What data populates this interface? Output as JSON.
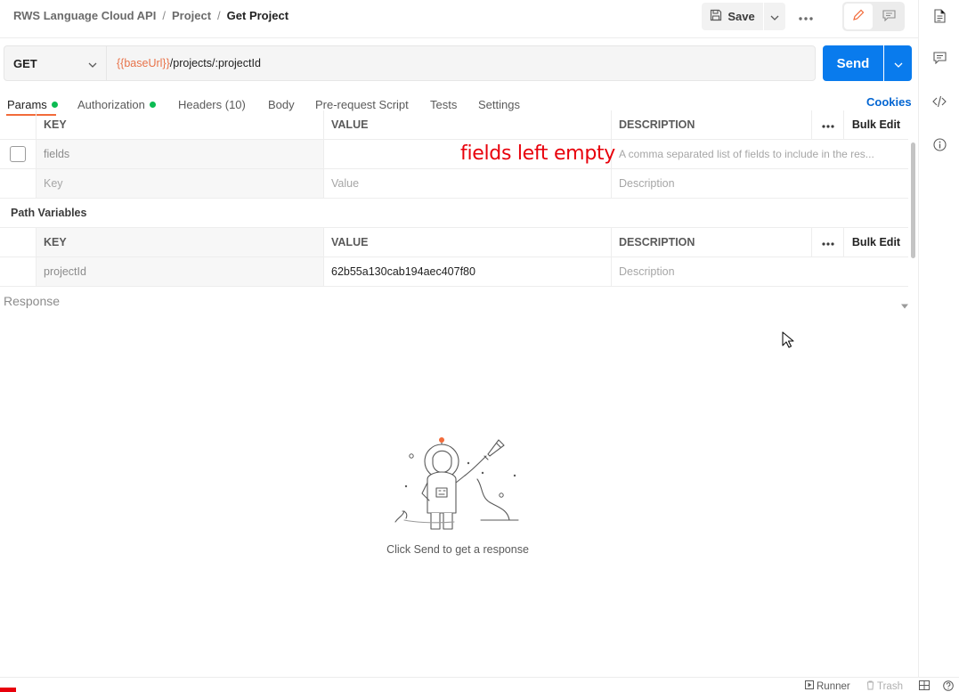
{
  "breadcrumb": {
    "items": [
      "RWS Language Cloud API",
      "Project"
    ],
    "separator": "/",
    "current": "Get Project"
  },
  "toolbar": {
    "save_label": "Save"
  },
  "request": {
    "method": "GET",
    "url_variable": "{{baseUrl}}",
    "url_path": "/projects/:projectId",
    "send_label": "Send"
  },
  "tabs": [
    {
      "label": "Params",
      "has_dot": true,
      "active": true
    },
    {
      "label": "Authorization",
      "has_dot": true,
      "active": false
    },
    {
      "label": "Headers (10)",
      "has_dot": false,
      "active": false
    },
    {
      "label": "Body",
      "has_dot": false,
      "active": false
    },
    {
      "label": "Pre-request Script",
      "has_dot": false,
      "active": false
    },
    {
      "label": "Tests",
      "has_dot": false,
      "active": false
    },
    {
      "label": "Settings",
      "has_dot": false,
      "active": false
    }
  ],
  "cookies_label": "Cookies",
  "query_params": {
    "headers": {
      "key": "KEY",
      "value": "VALUE",
      "description": "DESCRIPTION",
      "bulk_edit": "Bulk Edit"
    },
    "rows": [
      {
        "key": "fields",
        "value": "",
        "description": "A comma separated list of fields to include in the res..."
      }
    ],
    "new_row": {
      "key": "Key",
      "value": "Value",
      "description": "Description"
    }
  },
  "annotation": "fields left empty",
  "path_variables": {
    "title": "Path Variables",
    "headers": {
      "key": "KEY",
      "value": "VALUE",
      "description": "DESCRIPTION",
      "bulk_edit": "Bulk Edit"
    },
    "rows": [
      {
        "key": "projectId",
        "value": "62b55a130cab194aec407f80",
        "description": "Description"
      }
    ]
  },
  "response": {
    "label": "Response",
    "hint": "Click Send to get a response"
  },
  "statusbar": {
    "runner": "Runner",
    "trash": "Trash"
  },
  "colors": {
    "accent": "#097bed",
    "tab_underline": "#f26b3a",
    "url_variable": "#e8734a",
    "status_dot": "#0cbb52",
    "annotation": "#e8000b"
  },
  "icons": {
    "save": "save-icon",
    "more": "more-horizontal-icon",
    "edit": "pencil-icon",
    "comment": "comment-icon",
    "docs": "document-icon",
    "code": "code-icon",
    "info": "info-icon"
  }
}
